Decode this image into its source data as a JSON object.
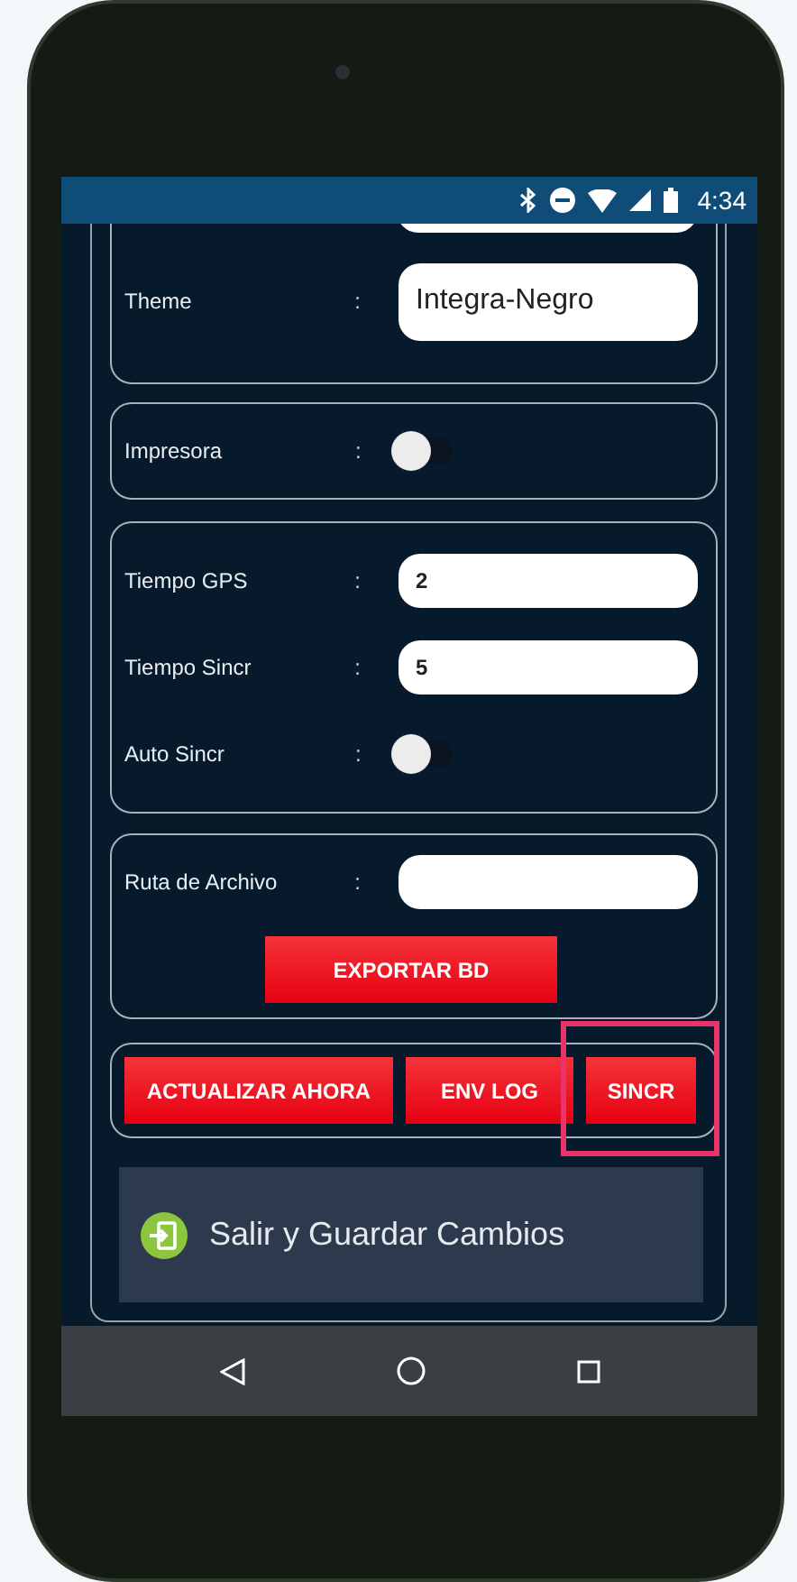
{
  "status_bar": {
    "time": "4:34"
  },
  "settings_groups": [
    {
      "rows": [
        {
          "kind": "cut_field"
        },
        {
          "kind": "text_field",
          "label": "Theme",
          "separator": ":",
          "value": "Integra-Negro"
        }
      ]
    },
    {
      "rows": [
        {
          "kind": "toggle",
          "label": "Impresora",
          "separator": ":",
          "on": false
        }
      ]
    },
    {
      "rows": [
        {
          "kind": "number_field",
          "label": "Tiempo GPS",
          "separator": ":",
          "value": "2"
        },
        {
          "kind": "number_field",
          "label": "Tiempo Sincr",
          "separator": ":",
          "value": "5"
        },
        {
          "kind": "toggle",
          "label": "Auto Sincr",
          "separator": ":",
          "on": false
        }
      ]
    },
    {
      "rows": [
        {
          "kind": "number_field",
          "label": "Ruta de Archivo",
          "separator": ":"
        }
      ],
      "button": "EXPORTAR BD"
    }
  ],
  "action_buttons": [
    {
      "label": "ACTUALIZAR AHORA",
      "highlighted": false
    },
    {
      "label": "ENV LOG",
      "highlighted": false
    },
    {
      "label": "SINCR",
      "highlighted": true
    }
  ],
  "exit_button": {
    "label": "Salir y Guardar Cambios"
  }
}
